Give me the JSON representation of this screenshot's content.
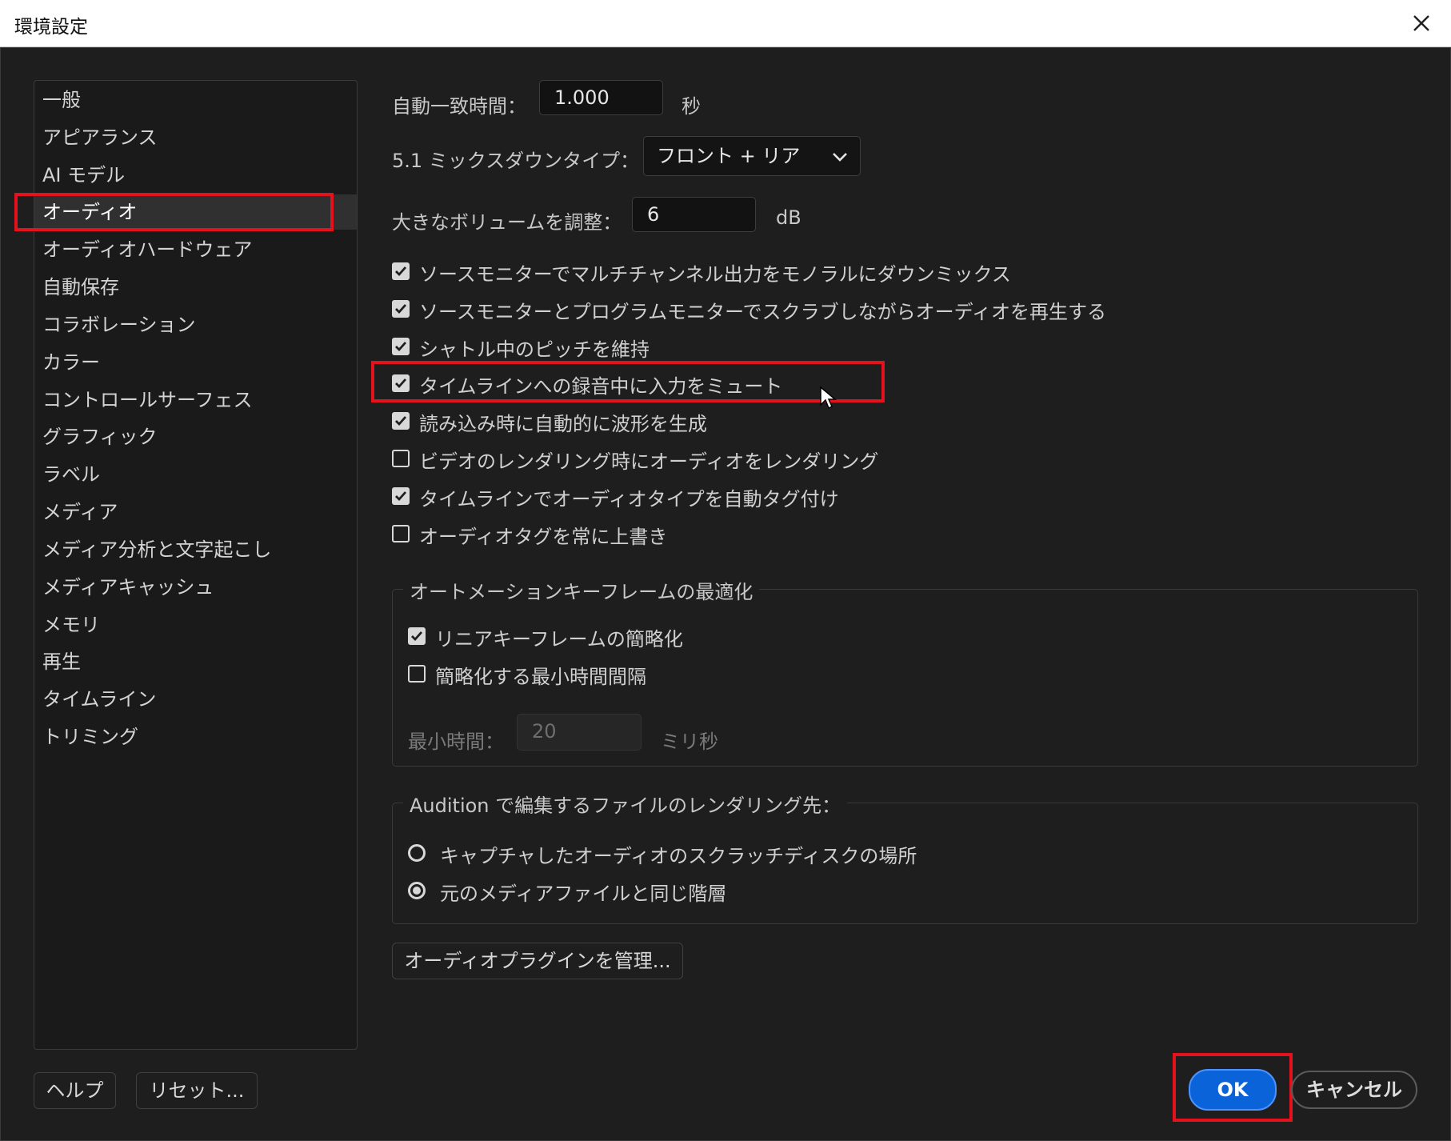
{
  "window": {
    "title": "環境設定"
  },
  "sidebar": {
    "items": [
      {
        "label": "一般"
      },
      {
        "label": "アピアランス"
      },
      {
        "label": "AI モデル"
      },
      {
        "label": "オーディオ"
      },
      {
        "label": "オーディオハードウェア"
      },
      {
        "label": "自動保存"
      },
      {
        "label": "コラボレーション"
      },
      {
        "label": "カラー"
      },
      {
        "label": "コントロールサーフェス"
      },
      {
        "label": "グラフィック"
      },
      {
        "label": "ラベル"
      },
      {
        "label": "メディア"
      },
      {
        "label": "メディア分析と文字起こし"
      },
      {
        "label": "メディアキャッシュ"
      },
      {
        "label": "メモリ"
      },
      {
        "label": "再生"
      },
      {
        "label": "タイムライン"
      },
      {
        "label": "トリミング"
      }
    ],
    "selected": "オーディオ"
  },
  "audio": {
    "auto_match": {
      "label": "自動一致時間：",
      "value": "1.000",
      "unit": "秒"
    },
    "mixdown": {
      "label": "5.1 ミックスダウンタイプ：",
      "value": "フロント + リア"
    },
    "large_volume": {
      "label": "大きなボリュームを調整：",
      "value": "6",
      "unit": "dB"
    },
    "checkboxes": [
      {
        "label": "ソースモニターでマルチチャンネル出力をモノラルにダウンミックス",
        "checked": true
      },
      {
        "label": "ソースモニターとプログラムモニターでスクラブしながらオーディオを再生する",
        "checked": true
      },
      {
        "label": "シャトル中のピッチを維持",
        "checked": true
      },
      {
        "label": "タイムラインへの録音中に入力をミュート",
        "checked": true
      },
      {
        "label": "読み込み時に自動的に波形を生成",
        "checked": true
      },
      {
        "label": "ビデオのレンダリング時にオーディオをレンダリング",
        "checked": false
      },
      {
        "label": "タイムラインでオーディオタイプを自動タグ付け",
        "checked": true
      },
      {
        "label": "オーディオタグを常に上書き",
        "checked": false
      }
    ],
    "keyframe_group": {
      "title": "オートメーションキーフレームの最適化",
      "linear": {
        "label": "リニアキーフレームの簡略化",
        "checked": true
      },
      "min_interval": {
        "label": "簡略化する最小時間間隔",
        "checked": false
      },
      "min_time": {
        "label": "最小時間：",
        "value": "20",
        "unit": "ミリ秒"
      }
    },
    "render_group": {
      "title": "Audition で編集するファイルのレンダリング先：",
      "options": [
        {
          "label": "キャプチャしたオーディオのスクラッチディスクの場所",
          "selected": false
        },
        {
          "label": "元のメディアファイルと同じ階層",
          "selected": true
        }
      ]
    },
    "manage_plugins": "オーディオプラグインを管理..."
  },
  "footer": {
    "help": "ヘルプ",
    "reset": "リセット...",
    "ok": "OK",
    "cancel": "キャンセル"
  },
  "colors": {
    "highlight": "#e3121c",
    "ok_button": "#0b63d9",
    "background": "#1e1e1e"
  }
}
